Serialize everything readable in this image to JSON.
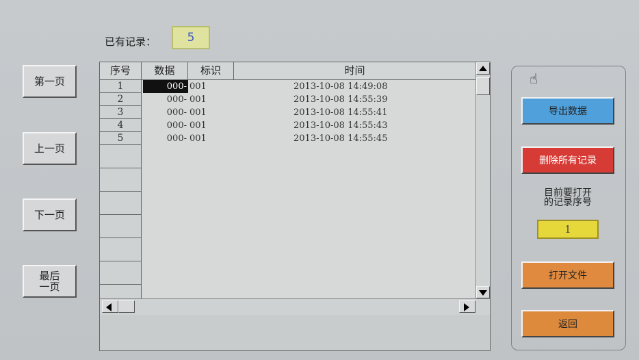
{
  "record_count": {
    "label": "已有记录：",
    "value": "5"
  },
  "nav": {
    "first": "第一页",
    "prev": "上一页",
    "next": "下一页",
    "last": "最后一页"
  },
  "table": {
    "headers": [
      "序号",
      "数据",
      "标识",
      "时间"
    ],
    "rows": [
      {
        "num": "1",
        "data": "000-",
        "mark": "001",
        "time": "2013-10-08 14:49:08"
      },
      {
        "num": "2",
        "data": "000-",
        "mark": "001",
        "time": "2013-10-08 14:55:39"
      },
      {
        "num": "3",
        "data": "000-",
        "mark": "001",
        "time": "2013-10-08 14:55:41"
      },
      {
        "num": "4",
        "data": "000-",
        "mark": "001",
        "time": "2013-10-08 14:55:43"
      },
      {
        "num": "5",
        "data": "000-",
        "mark": "001",
        "time": "2013-10-08 14:55:45"
      }
    ]
  },
  "panel": {
    "export": "导出数据",
    "delete_all": "删除所有记录",
    "open_title": "目前要打开的记录序号",
    "record_no": "1",
    "open_file": "打开文件",
    "back": "返回"
  },
  "colors": {
    "export": "#4fa0db",
    "delete": "#d63b36",
    "open": "#df8a3e",
    "record_box": "#e6d83a",
    "count_box": "#dfe39f"
  }
}
